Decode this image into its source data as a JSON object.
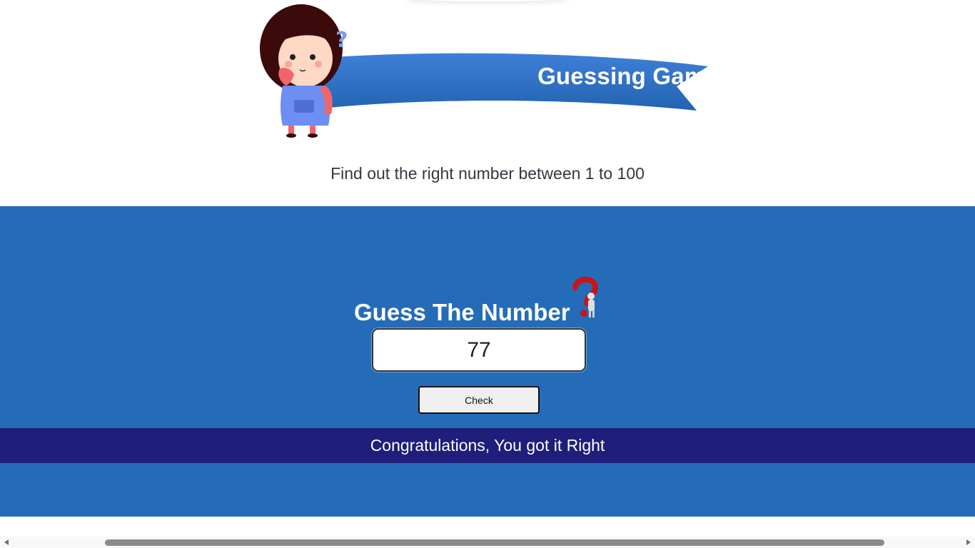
{
  "header": {
    "title": "Guessing Game",
    "subtitle": "Find out the right number between 1 to 100"
  },
  "game": {
    "heading": "Guess The Number",
    "input_value": "77",
    "check_label": "Check",
    "result_message": "Congratulations, You got it Right"
  },
  "icons": {
    "character": "girl-thinking-icon",
    "question": "question-mark-figure-icon"
  },
  "colors": {
    "panel": "#246cb8",
    "ribbon": "#2e6fc4",
    "result_bar": "#1f1e7a"
  }
}
